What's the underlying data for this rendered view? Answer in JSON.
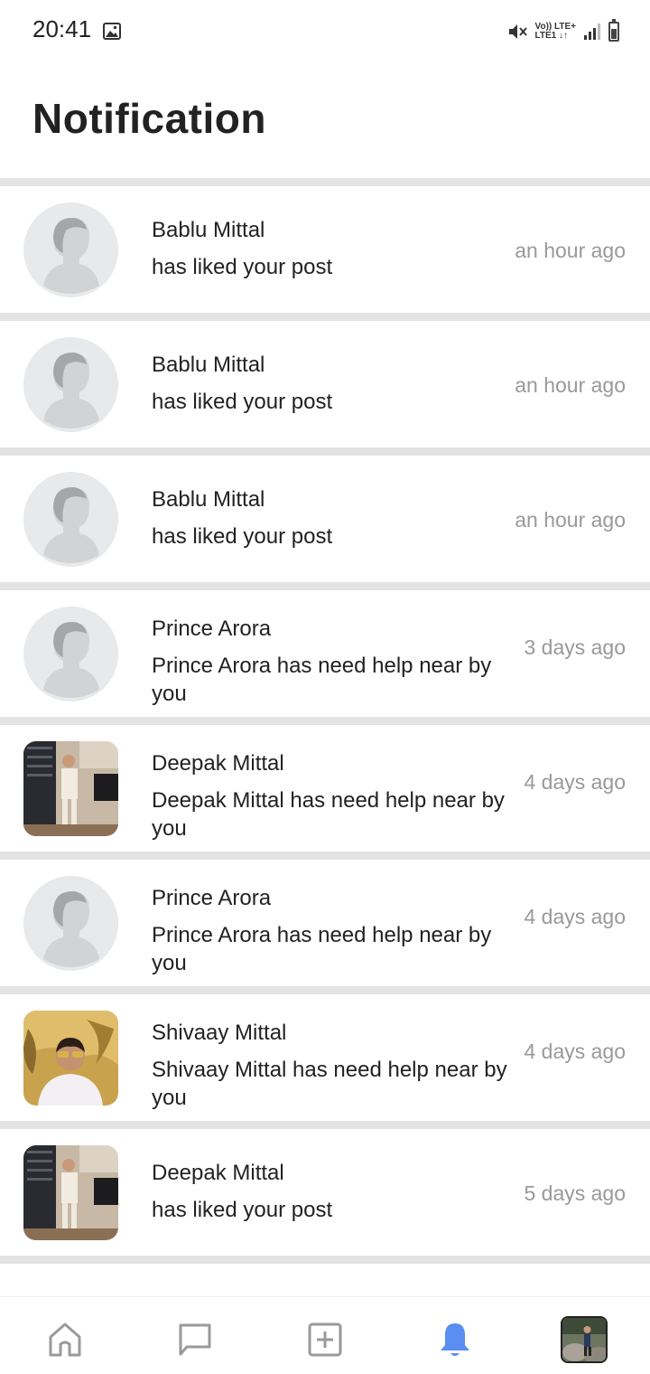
{
  "status_bar": {
    "time": "20:41",
    "network_line1": "Vo)) LTE+",
    "network_line2": "LTE1 ↓↑"
  },
  "header": {
    "title": "Notification"
  },
  "notifications": [
    {
      "name": "Bablu Mittal",
      "message": "has liked your post",
      "time": "an hour ago",
      "avatar": "default"
    },
    {
      "name": "Bablu Mittal",
      "message": "has liked your post",
      "time": "an hour ago",
      "avatar": "default"
    },
    {
      "name": "Bablu Mittal",
      "message": "has liked your post",
      "time": "an hour ago",
      "avatar": "default"
    },
    {
      "name": "Prince Arora",
      "message": "Prince Arora has need help near by you",
      "time": "3 days ago",
      "avatar": "default"
    },
    {
      "name": "Deepak Mittal",
      "message": "Deepak Mittal has need help near by you",
      "time": "4 days ago",
      "avatar": "photo-room"
    },
    {
      "name": "Prince Arora",
      "message": "Prince Arora has need help near by you",
      "time": "4 days ago",
      "avatar": "default"
    },
    {
      "name": "Shivaay Mittal",
      "message": "Shivaay Mittal has need help near by you",
      "time": "4 days ago",
      "avatar": "photo-boy"
    },
    {
      "name": "Deepak Mittal",
      "message": "has liked your post",
      "time": "5 days ago",
      "avatar": "photo-room"
    }
  ],
  "bottom_nav": {
    "items": [
      "home-icon",
      "chat-icon",
      "add-post-icon",
      "bell-icon",
      "profile-avatar"
    ],
    "active": "bell-icon",
    "active_color": "#5a8ef0",
    "inactive_color": "#9a9a9a"
  }
}
